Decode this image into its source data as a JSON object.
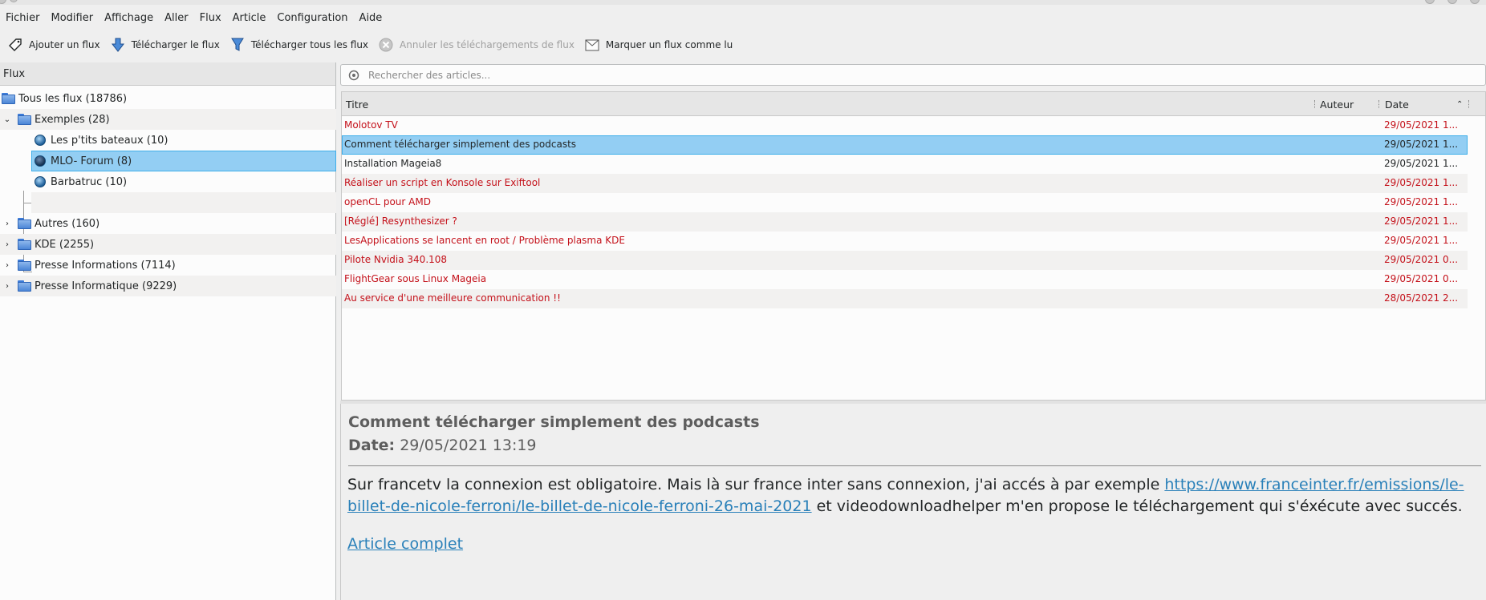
{
  "menu": [
    {
      "label": "Fichier",
      "key": "F"
    },
    {
      "label": "Modifier",
      "key": "i"
    },
    {
      "label": "Affichage",
      "key": "A"
    },
    {
      "label": "Aller",
      "key": "A"
    },
    {
      "label": "Flux",
      "key": "l"
    },
    {
      "label": "Article",
      "key": "A"
    },
    {
      "label": "Configuration",
      "key": "C"
    },
    {
      "label": "Aide",
      "key": "A"
    }
  ],
  "toolbar": {
    "add_feed": "Ajouter un flux",
    "fetch_feed": "Télécharger le flux",
    "fetch_all": "Télécharger tous les flux",
    "abort": "Annuler les téléchargements de flux",
    "mark_read": "Marquer un flux comme lu"
  },
  "feeds": {
    "header": "Flux",
    "all": "Tous les flux (18786)",
    "exemples": "Exemples (28)",
    "bateaux": "Les p'tits bateaux (10)",
    "mlo": "MLO- Forum (8)",
    "barbatruc": "Barbatruc (10)",
    "autres": "Autres (160)",
    "kde": "KDE (2255)",
    "presse_info": "Presse Informations (7114)",
    "presse_informatique": "Presse Informatique (9229)"
  },
  "search": {
    "placeholder": "Rechercher des articles..."
  },
  "articles": {
    "headers": {
      "title": "Titre",
      "author": "Auteur",
      "date": "Date"
    },
    "rows": [
      {
        "title": "Molotov TV",
        "date": "29/05/2021 1...",
        "state": "unread"
      },
      {
        "title": "Comment télécharger simplement des podcasts",
        "date": "29/05/2021 1...",
        "state": "selected"
      },
      {
        "title": "Installation Mageia8",
        "date": "29/05/2021 1...",
        "state": "read"
      },
      {
        "title": "Réaliser un script en Konsole sur Exiftool",
        "date": "29/05/2021 1...",
        "state": "unread"
      },
      {
        "title": "openCL pour AMD",
        "date": "29/05/2021 1...",
        "state": "unread"
      },
      {
        "title": "[Réglé] Resynthesizer ?",
        "date": "29/05/2021 1...",
        "state": "unread"
      },
      {
        "title": "LesApplications se lancent en root / Problème plasma KDE",
        "date": "29/05/2021 1...",
        "state": "unread"
      },
      {
        "title": "Pilote Nvidia 340.108",
        "date": "29/05/2021 0...",
        "state": "unread"
      },
      {
        "title": "FlightGear sous Linux Mageia",
        "date": "29/05/2021 0...",
        "state": "unread"
      },
      {
        "title": "Au service d'une meilleure communication !!",
        "date": "28/05/2021 2...",
        "state": "unread"
      }
    ]
  },
  "article_view": {
    "title": "Comment télécharger simplement des podcasts",
    "date_label": "Date:",
    "date_value": "29/05/2021 13:19",
    "body_before": "Sur francetv la connexion est obligatoire. Mais là sur france inter sans connexion, j'ai accés à par exemple ",
    "link": "https://www.franceinter.fr/emissions/le-billet-de-nicole-ferroni/le-billet-de-nicole-ferroni-26-mai-2021",
    "body_after": " et videodownloadhelper m'en propose le téléchargement qui s'éxécute avec succés.",
    "full_article": "Article complet"
  },
  "colors": {
    "unread": "#c4111a",
    "selection": "#93cef3",
    "link": "#2980b9"
  }
}
